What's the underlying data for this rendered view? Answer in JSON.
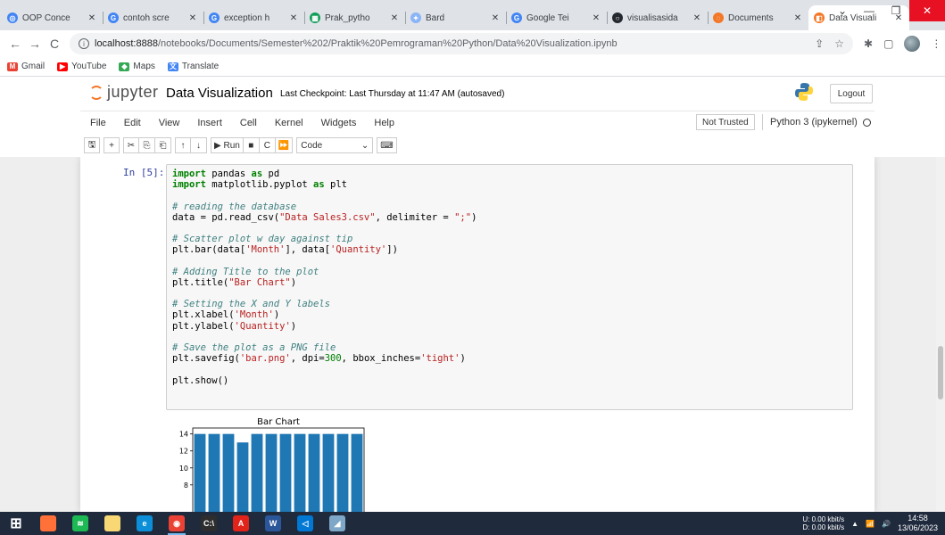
{
  "browser": {
    "tabs": [
      {
        "title": "OOP Conce",
        "color": "#4285f4",
        "glyph": "◎"
      },
      {
        "title": "contoh scre",
        "color": "#4285f4",
        "glyph": "G"
      },
      {
        "title": "exception h",
        "color": "#4285f4",
        "glyph": "G"
      },
      {
        "title": "Prak_pytho",
        "color": "#0f9d58",
        "glyph": "▦"
      },
      {
        "title": "Bard",
        "color": "#8ab4f8",
        "glyph": "✦"
      },
      {
        "title": "Google Tei",
        "color": "#4285f4",
        "glyph": "G"
      },
      {
        "title": "visualisasida",
        "color": "#24292f",
        "glyph": "○"
      },
      {
        "title": "Documents",
        "color": "#f37726",
        "glyph": "◌"
      },
      {
        "title": "Data Visuali",
        "color": "#f37726",
        "glyph": "◧",
        "active": true
      }
    ],
    "url_host": "localhost:8888",
    "url_path": "/notebooks/Documents/Semester%202/Praktik%20Pemrograman%20Python/Data%20Visualization.ipynb",
    "bookmarks": [
      {
        "label": "Gmail",
        "color": "#ea4335",
        "glyph": "M"
      },
      {
        "label": "YouTube",
        "color": "#ff0000",
        "glyph": "▶"
      },
      {
        "label": "Maps",
        "color": "#34a853",
        "glyph": "◆"
      },
      {
        "label": "Translate",
        "color": "#4285f4",
        "glyph": "文"
      }
    ]
  },
  "jupyter": {
    "logo_text": "jupyter",
    "notebook_name": "Data Visualization",
    "checkpoint": "Last Checkpoint: Last Thursday at 11:47 AM  (autosaved)",
    "logout_label": "Logout",
    "menu": [
      "File",
      "Edit",
      "View",
      "Insert",
      "Cell",
      "Kernel",
      "Widgets",
      "Help"
    ],
    "trust_label": "Not Trusted",
    "kernel_label": "Python 3 (ipykernel)",
    "toolbar": {
      "run_label": "Run",
      "cell_type": "Code"
    }
  },
  "cell": {
    "prompt": "In [5]:",
    "code_lines": [
      [
        {
          "t": "import",
          "c": "kw"
        },
        {
          "t": " pandas "
        },
        {
          "t": "as",
          "c": "kw"
        },
        {
          "t": " pd"
        }
      ],
      [
        {
          "t": "import",
          "c": "kw"
        },
        {
          "t": " matplotlib.pyplot "
        },
        {
          "t": "as",
          "c": "kw"
        },
        {
          "t": " plt"
        }
      ],
      [],
      [
        {
          "t": "# reading the database",
          "c": "cm"
        }
      ],
      [
        {
          "t": "data = pd.read_csv("
        },
        {
          "t": "\"Data Sales3.csv\"",
          "c": "st"
        },
        {
          "t": ", delimiter = "
        },
        {
          "t": "\";\"",
          "c": "st"
        },
        {
          "t": ")"
        }
      ],
      [],
      [
        {
          "t": "# Scatter plot w day against tip",
          "c": "cm"
        }
      ],
      [
        {
          "t": "plt.bar(data["
        },
        {
          "t": "'Month'",
          "c": "st"
        },
        {
          "t": "], data["
        },
        {
          "t": "'Quantity'",
          "c": "st"
        },
        {
          "t": "])"
        }
      ],
      [],
      [
        {
          "t": "# Adding Title to the plot",
          "c": "cm"
        }
      ],
      [
        {
          "t": "plt.title("
        },
        {
          "t": "\"Bar Chart\"",
          "c": "st"
        },
        {
          "t": ")"
        }
      ],
      [],
      [
        {
          "t": "# Setting the X and Y labels",
          "c": "cm"
        }
      ],
      [
        {
          "t": "plt.xlabel("
        },
        {
          "t": "'Month'",
          "c": "st"
        },
        {
          "t": ")"
        }
      ],
      [
        {
          "t": "plt.ylabel("
        },
        {
          "t": "'Quantity'",
          "c": "st"
        },
        {
          "t": ")"
        }
      ],
      [],
      [
        {
          "t": "# Save the plot as a PNG file",
          "c": "cm"
        }
      ],
      [
        {
          "t": "plt.savefig("
        },
        {
          "t": "'bar.png'",
          "c": "st"
        },
        {
          "t": ", dpi="
        },
        {
          "t": "300",
          "c": "nu"
        },
        {
          "t": ", bbox_inches="
        },
        {
          "t": "'tight'",
          "c": "st"
        },
        {
          "t": ")"
        }
      ],
      [],
      [
        {
          "t": "plt.show()"
        }
      ]
    ]
  },
  "chart_data": {
    "type": "bar",
    "title": "Bar Chart",
    "ylabel_visible": "antity",
    "yticks": [
      8,
      10,
      12,
      14
    ],
    "values": [
      14,
      14,
      14,
      13,
      14,
      14,
      14,
      14,
      14,
      14,
      14,
      14
    ],
    "ylim": [
      0,
      14.7
    ],
    "bar_color": "#1f77b4"
  },
  "taskbar": {
    "apps": [
      {
        "name": "windows-start-icon",
        "color": "#ffffff",
        "glyph": "⊞"
      },
      {
        "name": "firefox-icon",
        "color": "#ff7139",
        "glyph": ""
      },
      {
        "name": "spotify-icon",
        "color": "#1db954",
        "glyph": "≋"
      },
      {
        "name": "file-explorer-icon",
        "color": "#f8d775",
        "glyph": ""
      },
      {
        "name": "edge-icon",
        "color": "#0c8fd8",
        "glyph": "e"
      },
      {
        "name": "chrome-icon",
        "color": "#ea4335",
        "glyph": "◉",
        "running": true
      },
      {
        "name": "terminal-icon",
        "color": "#2d2d2d",
        "glyph": "C:\\"
      },
      {
        "name": "acrobat-icon",
        "color": "#e2231a",
        "glyph": "A"
      },
      {
        "name": "word-icon",
        "color": "#2b579a",
        "glyph": "W"
      },
      {
        "name": "vscode-icon",
        "color": "#0078d4",
        "glyph": "◁"
      },
      {
        "name": "app-icon",
        "color": "#7fa7c7",
        "glyph": "◢"
      }
    ],
    "net_up": "0.00 kbit/s",
    "net_down": "0.00 kbit/s",
    "net_up_label": "U:",
    "net_down_label": "D:",
    "time": "14:58",
    "date": "13/06/2023"
  }
}
